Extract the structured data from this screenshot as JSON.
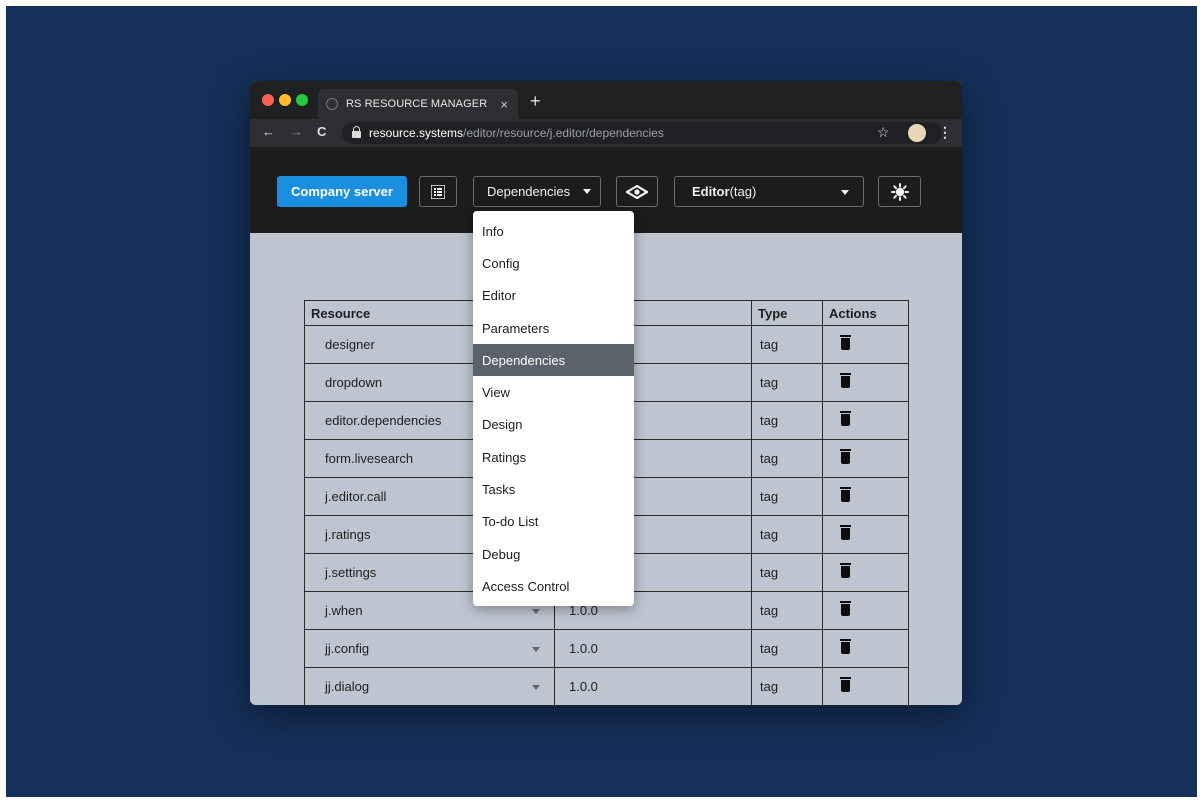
{
  "colors": {
    "backdrop": "#15305a",
    "primary_button": "#1a8fe0",
    "active_menu_item": "#5c626b",
    "app_header": "#1b1c1e",
    "content_bg": "#bec4d0"
  },
  "browser": {
    "tab_title": "RS RESOURCE MANAGER",
    "tab_close": "×",
    "new_tab": "+",
    "back": "←",
    "forward": "→",
    "reload": "C",
    "url_host": "resource.systems",
    "url_path": "/editor/resource/j.editor/dependencies",
    "star": "☆",
    "menu": "⋮"
  },
  "toolbar": {
    "server_button": "Company server",
    "list_icon": "list-icon",
    "section_select": "Dependencies",
    "preview_icon": "eye-icon",
    "resource_select_bold": "Editor",
    "resource_select_type": " (tag)",
    "theme_icon": "sun-icon"
  },
  "dropdown_menu": {
    "items": [
      "Info",
      "Config",
      "Editor",
      "Parameters",
      "Dependencies",
      "View",
      "Design",
      "Ratings",
      "Tasks",
      "To-do List",
      "Debug",
      "Access Control"
    ],
    "selected": "Dependencies"
  },
  "table": {
    "headers": [
      "Resource",
      "",
      "Type",
      "Actions"
    ],
    "rows": [
      {
        "resource": "designer",
        "version": "",
        "type": "tag"
      },
      {
        "resource": "dropdown",
        "version": "",
        "type": "tag"
      },
      {
        "resource": "editor.dependencies",
        "version": "",
        "type": "tag"
      },
      {
        "resource": "form.livesearch",
        "version": "",
        "type": "tag"
      },
      {
        "resource": "j.editor.call",
        "version": "",
        "type": "tag"
      },
      {
        "resource": "j.ratings",
        "version": "",
        "type": "tag"
      },
      {
        "resource": "j.settings",
        "version": "",
        "type": "tag"
      },
      {
        "resource": "j.when",
        "version": "1.0.0",
        "type": "tag"
      },
      {
        "resource": "jj.config",
        "version": "1.0.0",
        "type": "tag"
      },
      {
        "resource": "jj.dialog",
        "version": "1.0.0",
        "type": "tag"
      }
    ]
  }
}
